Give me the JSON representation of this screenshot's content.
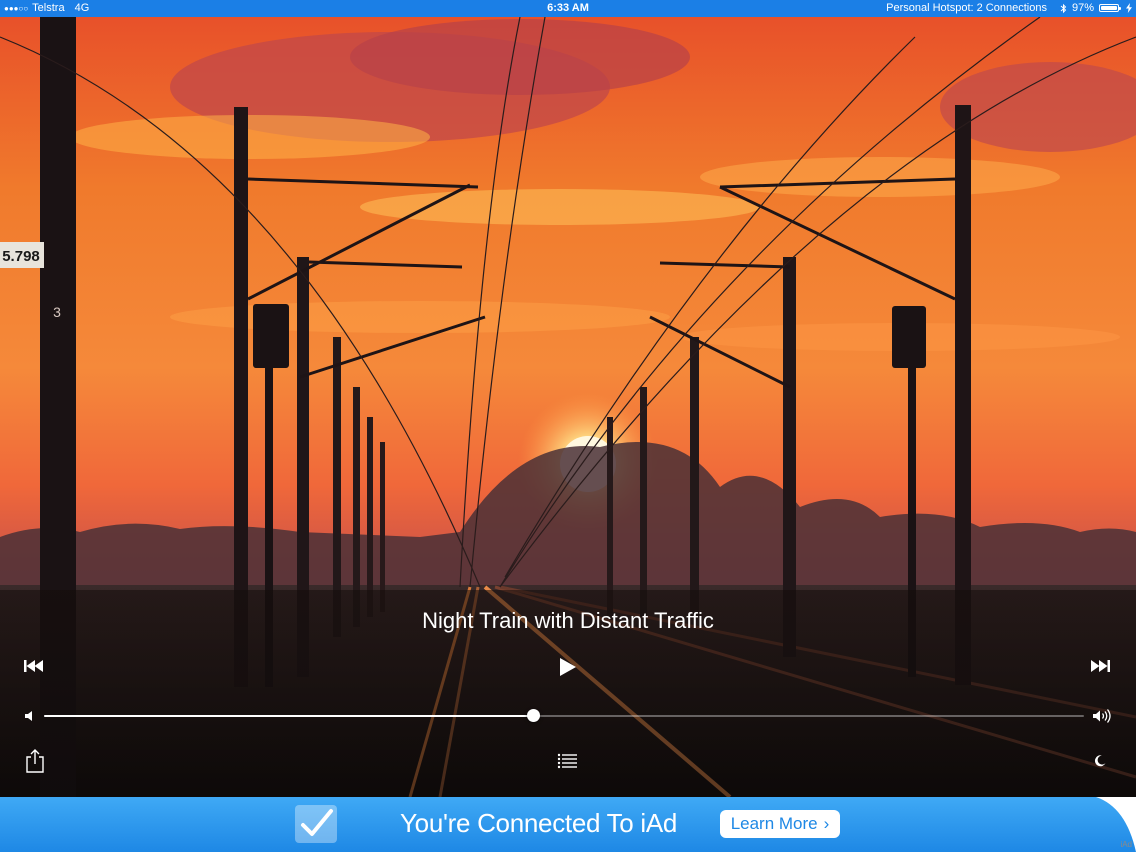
{
  "status_bar": {
    "carrier": "Telstra",
    "network": "4G",
    "time": "6:33 AM",
    "hotspot": "Personal Hotspot: 2 Connections",
    "battery_percent": "97%",
    "icons": [
      "signal-dots-icon",
      "bluetooth-icon",
      "battery-icon",
      "charging-icon"
    ]
  },
  "scene": {
    "sign_text": "5.798",
    "pole_marker": "3"
  },
  "player": {
    "track_title": "Night Train with Distant Traffic",
    "volume_level": 0.47,
    "icons": [
      "previous-track-icon",
      "play-icon",
      "next-track-icon",
      "volume-low-icon",
      "volume-high-icon",
      "share-icon",
      "playlist-icon",
      "moon-icon"
    ]
  },
  "ad": {
    "headline": "You're Connected To iAd",
    "button_label": "Learn More",
    "button_chevron": "›",
    "mark": "iAd",
    "colors": {
      "banner": "#1e88e5",
      "status_bar": "#1b7fe6"
    }
  }
}
